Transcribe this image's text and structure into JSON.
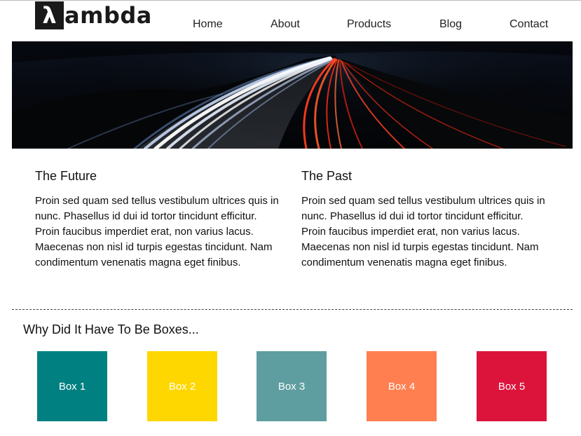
{
  "header": {
    "logo": {
      "mark": "λ",
      "text": "ambda"
    },
    "nav": [
      {
        "label": "Home"
      },
      {
        "label": "About"
      },
      {
        "label": "Products"
      },
      {
        "label": "Blog"
      },
      {
        "label": "Contact"
      }
    ]
  },
  "columns": [
    {
      "title": "The Future",
      "body": "Proin sed quam sed tellus vestibulum ultrices quis in nunc. Phasellus id dui id tortor tincidunt efficitur. Proin faucibus imperdiet erat, non varius lacus. Maecenas non nisl id turpis egestas tincidunt. Nam condimentum venenatis magna eget finibus."
    },
    {
      "title": "The Past",
      "body": "Proin sed quam sed tellus vestibulum ultrices quis in nunc. Phasellus id dui id tortor tincidunt efficitur. Proin faucibus imperdiet erat, non varius lacus. Maecenas non nisl id turpis egestas tincidunt. Nam condimentum venenatis magna eget finibus."
    }
  ],
  "boxes_section": {
    "title": "Why Did It Have To Be Boxes...",
    "boxes": [
      {
        "label": "Box 1",
        "color": "#008080"
      },
      {
        "label": "Box 2",
        "color": "#FFD700"
      },
      {
        "label": "Box 3",
        "color": "#5F9EA0"
      },
      {
        "label": "Box 4",
        "color": "#FF7F50"
      },
      {
        "label": "Box 5",
        "color": "#DC143C"
      }
    ]
  }
}
